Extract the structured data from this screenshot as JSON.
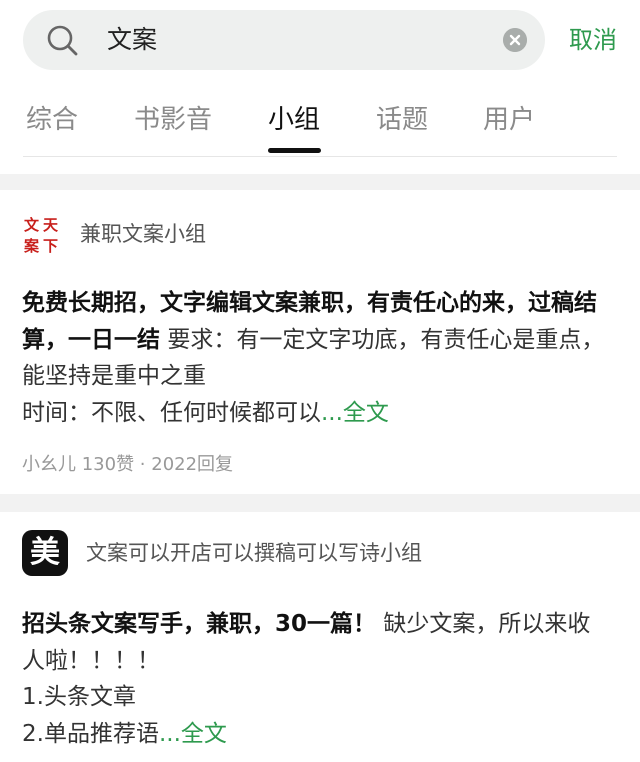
{
  "search": {
    "query": "文案",
    "cancel_label": "取消"
  },
  "tabs": [
    {
      "label": "综合"
    },
    {
      "label": "书影音"
    },
    {
      "label": "小组"
    },
    {
      "label": "话题"
    },
    {
      "label": "用户"
    }
  ],
  "active_tab": "小组",
  "posts": [
    {
      "group_name": "兼职文案小组",
      "group_logo_text": [
        "文",
        "天",
        "案",
        "下"
      ],
      "title": "免费长期招，文字编辑文案兼职，有责任心的来，过稿结算，一日一结",
      "body_lines": [
        "要求：有一定文字功底，有责任心是重点，能坚持是重中之重",
        "时间：不限、任何时候都可以"
      ],
      "more_label": "...全文",
      "meta": "小幺儿 130赞 · 2022回复"
    },
    {
      "group_name": "文案可以开店可以撰稿可以写诗小组",
      "group_logo_text": "美",
      "title": "招头条文案写手，兼职，30一篇！",
      "body_lines": [
        "缺少文案，所以来收人啦！！！！",
        "1.头条文章",
        "2.单品推荐语"
      ],
      "more_label": "...全文"
    }
  ],
  "colors": {
    "accent": "#2e9a4e",
    "logo_red": "#c8201c",
    "search_bg": "#eef0ef"
  }
}
